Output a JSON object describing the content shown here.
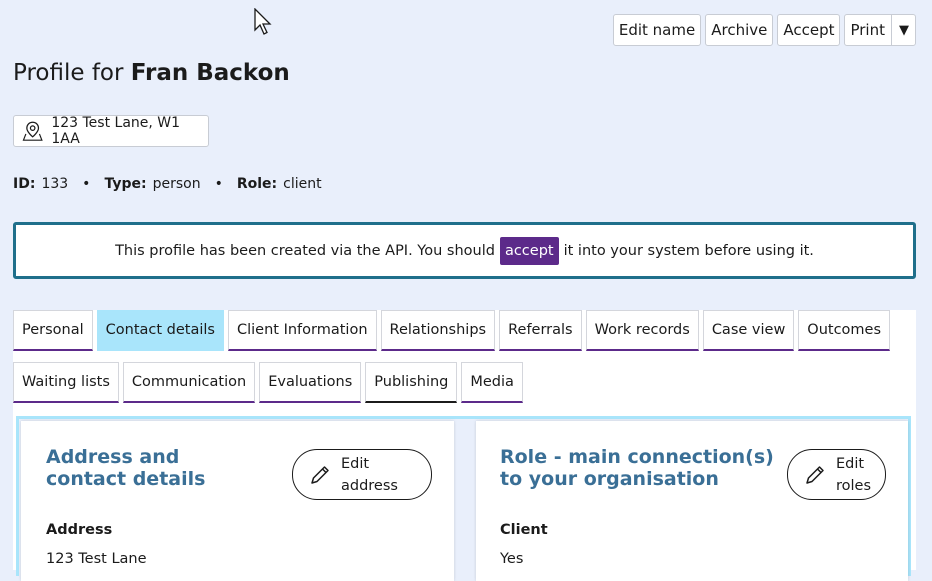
{
  "toolbar": {
    "edit_name": "Edit name",
    "archive": "Archive",
    "accept": "Accept",
    "print": "Print",
    "print_caret": "▼"
  },
  "profile": {
    "title_prefix": "Profile for",
    "name": "Fran Backon",
    "address": "123 Test Lane, W1 1AA",
    "id_label": "ID:",
    "id_value": "133",
    "type_label": "Type:",
    "type_value": "person",
    "role_label": "Role:",
    "role_value": "client",
    "separator": "•"
  },
  "notice": {
    "before": "This profile has been created via the API. You should",
    "link": "accept",
    "after": "it into your system before using it."
  },
  "tabs": {
    "row1": [
      "Personal",
      "Contact details",
      "Client Information",
      "Relationships",
      "Referrals",
      "Work records",
      "Case view",
      "Outcomes"
    ],
    "row2": [
      "Waiting lists",
      "Communication",
      "Evaluations",
      "Publishing",
      "Media"
    ],
    "active": "Contact details"
  },
  "cards": {
    "address": {
      "heading_line1": "Address and",
      "heading_line2": "contact details",
      "edit_line1": "Edit",
      "edit_line2": "address",
      "field_label": "Address",
      "field_value": "123 Test Lane"
    },
    "role": {
      "heading_line1": "Role - main connection(s)",
      "heading_line2": "to your organisation",
      "edit_line1": "Edit",
      "edit_line2": "roles",
      "field_label": "Client",
      "field_value": "Yes"
    }
  },
  "colors": {
    "background": "#e9effb",
    "accent_purple": "#5c2a8a",
    "active_tab": "#a9e5fb",
    "heading_blue": "#3a6f96",
    "notice_border": "#1f6f8b"
  }
}
